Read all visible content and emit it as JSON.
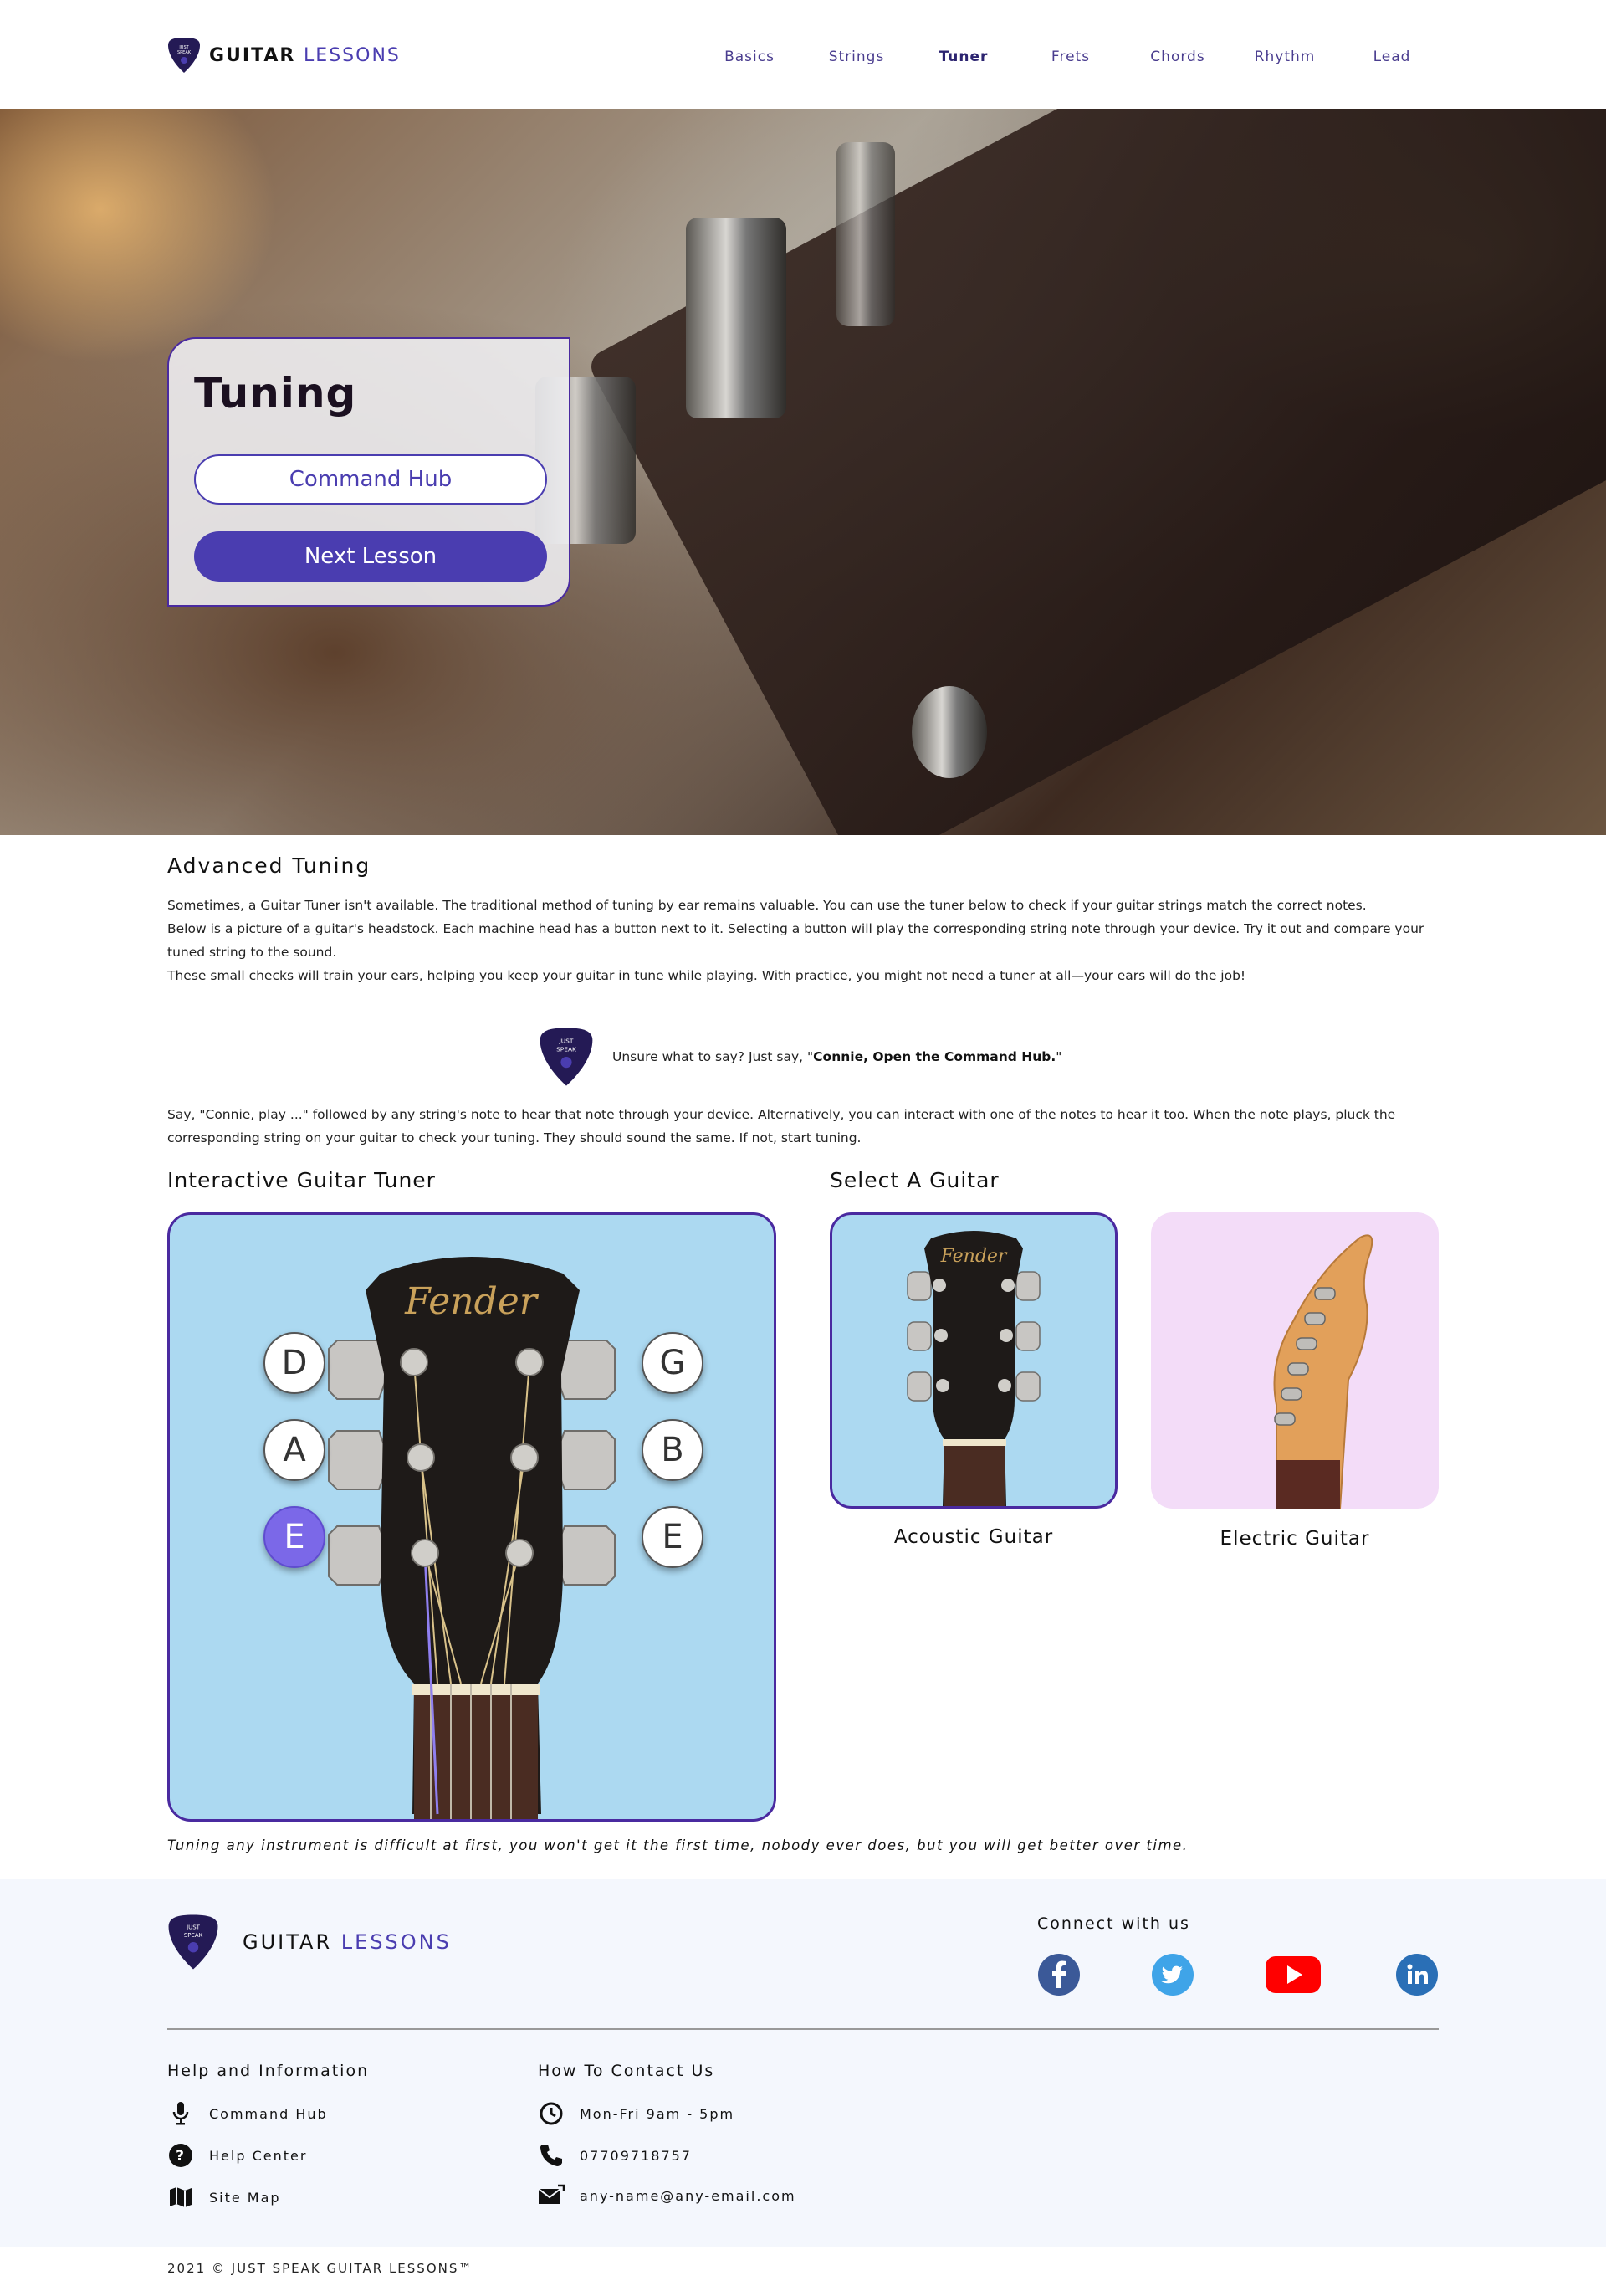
{
  "header": {
    "logo_word1": "GUITAR",
    "logo_word2": "LESSONS",
    "nav": [
      "Basics",
      "Strings",
      "Tuner",
      "Frets",
      "Chords",
      "Rhythm",
      "Lead"
    ],
    "active_nav": "Tuner"
  },
  "hero": {
    "title": "Tuning",
    "primary_button": "Command Hub",
    "secondary_button": "Next Lesson"
  },
  "content": {
    "heading": "Advanced Tuning",
    "p1": "Sometimes, a Guitar Tuner isn't available. The traditional method of tuning by ear remains valuable. You can use the tuner below to check if your guitar strings match the correct notes.",
    "p2": "Below is a picture of a guitar's headstock. Each machine head has a button next to it. Selecting a button will play the corresponding string note through your device. Try it out and compare your tuned string to the sound.",
    "p3": "These small checks will train your ears, helping you keep your guitar in tune while playing. With practice, you might not need a tuner at all—your ears will do the job!",
    "hint_prefix": "Unsure what to say? Just say, \"",
    "hint_command": "Connie, Open the Command Hub.",
    "hint_suffix": "\"",
    "p4": "Say, \"Connie, play ...\" followed by any string's note to hear that note through your device. Alternatively, you can interact with one of the notes to hear it too. When the note plays, pluck the corresponding string on your guitar to check your tuning. They should sound the same. If not, start tuning.",
    "tuner_title": "Interactive Guitar Tuner",
    "select_title": "Select A Guitar",
    "notes_left": [
      "D",
      "A",
      "E"
    ],
    "notes_right": [
      "G",
      "B",
      "E"
    ],
    "active_note": "E (low)",
    "headstock_brand": "Fender",
    "guitars": [
      "Acoustic Guitar",
      "Electric Guitar"
    ],
    "selected_guitar": "Acoustic Guitar",
    "quote": "Tuning any instrument is difficult at first, you won't get it the first time, nobody ever does, but you will get better over time."
  },
  "footer": {
    "logo_word1": "GUITAR",
    "logo_word2": "LESSONS",
    "connect": "Connect with us",
    "social": [
      "facebook-icon",
      "twitter-icon",
      "youtube-icon",
      "linkedin-icon"
    ],
    "help_title": "Help and Information",
    "help_items": [
      "Command Hub",
      "Help Center",
      "Site Map"
    ],
    "contact_title": "How To Contact Us",
    "contact_items": [
      "Mon-Fri 9am - 5pm",
      "07709718757",
      "any-name@any-email.com"
    ],
    "copyright": "2021 © JUST SPEAK GUITAR LESSONS™"
  },
  "colors": {
    "brand": "#4a3db0",
    "border": "#4a2aa0",
    "tuner_bg": "#acd9f1",
    "electric_bg": "#f3dcf8",
    "active_note": "#7b68e8"
  }
}
